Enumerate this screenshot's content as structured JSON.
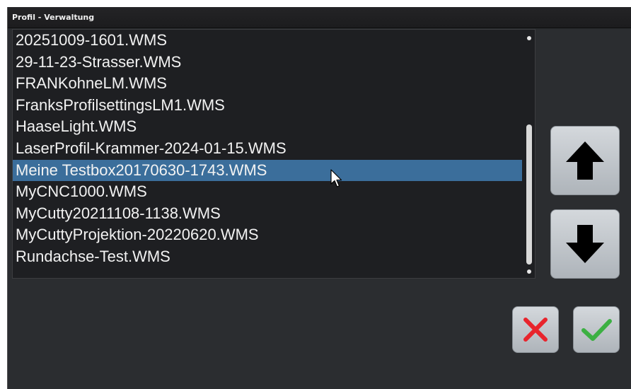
{
  "window": {
    "title": "Profil - Verwaltung"
  },
  "profile_list": {
    "selected_index": 6,
    "items": [
      {
        "label": "20251009-1601.WMS"
      },
      {
        "label": "29-11-23-Strasser.WMS"
      },
      {
        "label": "FRANKohneLM.WMS"
      },
      {
        "label": "FranksProfilsettingsLM1.WMS"
      },
      {
        "label": "HaaseLight.WMS"
      },
      {
        "label": "LaserProfil-Krammer-2024-01-15.WMS"
      },
      {
        "label": "Meine Testbox20170630-1743.WMS"
      },
      {
        "label": "MyCNC1000.WMS"
      },
      {
        "label": "MyCutty20211108-1138.WMS"
      },
      {
        "label": "MyCuttyProjektion-20220620.WMS"
      },
      {
        "label": "Rundachse-Test.WMS"
      }
    ]
  },
  "buttons": {
    "move_up_icon": "arrow-up-icon",
    "move_down_icon": "arrow-down-icon",
    "cancel_icon": "cross-icon",
    "confirm_icon": "check-icon"
  },
  "colors": {
    "selection": "#3b6e9b",
    "cancel_red": "#e8242c",
    "confirm_green": "#3cb043"
  }
}
